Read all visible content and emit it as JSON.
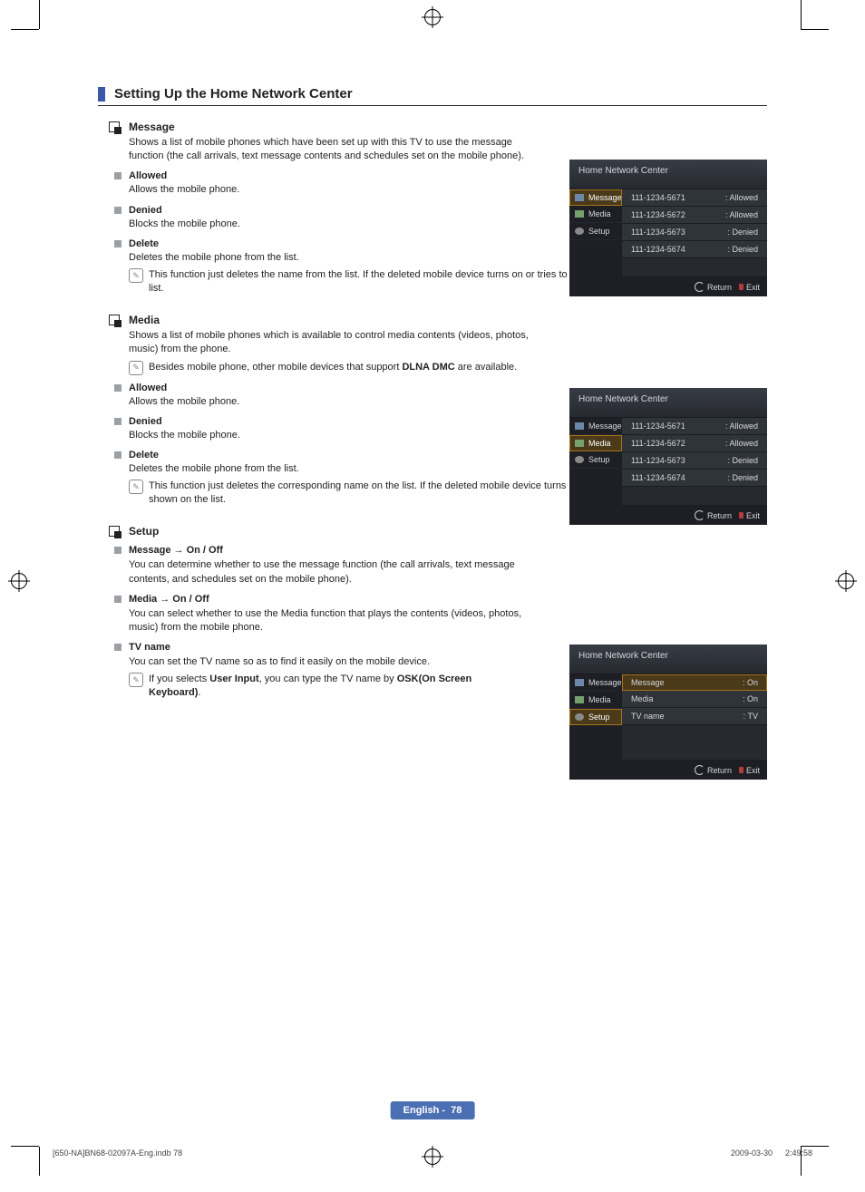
{
  "title": "Setting Up the Home Network Center",
  "sections": {
    "message": {
      "label": "Message",
      "desc": "Shows a list of mobile phones which have been set up with this TV to use the message function (the call arrivals, text message contents and schedules set on the mobile phone).",
      "allowed": {
        "label": "Allowed",
        "text": "Allows the mobile phone."
      },
      "denied": {
        "label": "Denied",
        "text": "Blocks the mobile phone."
      },
      "delete": {
        "label": "Delete",
        "text": "Deletes the mobile phone from the list.",
        "note": "This function just deletes the name from the list. If the deleted mobile device turns on or tries to connect to the TV, it may be shown on the list."
      }
    },
    "media": {
      "label": "Media",
      "desc": "Shows a list of mobile phones which is available to control media contents (videos, photos, music) from the phone.",
      "note_prefix": "Besides mobile phone, other mobile devices that support ",
      "note_bold": "DLNA DMC",
      "note_suffix": " are available.",
      "allowed": {
        "label": "Allowed",
        "text": "Allows the mobile phone."
      },
      "denied": {
        "label": "Denied",
        "text": "Blocks the mobile phone."
      },
      "delete": {
        "label": "Delete",
        "text": "Deletes the mobile phone from the list.",
        "note": "This function just deletes the corresponding name on the list. If the deleted mobile device turns on or tries to connect to the TV, it may be shown on the list."
      }
    },
    "setup": {
      "label": "Setup",
      "msg": {
        "label": "Message → On / Off",
        "text": "You can determine whether to use the message function (the call arrivals, text message contents, and schedules set on the mobile phone)."
      },
      "media": {
        "label": "Media → On / Off",
        "text": "You can select whether to use the Media function that plays the contents (videos, photos, music) from the mobile phone."
      },
      "tv": {
        "label": "TV name",
        "text": "You can set the TV name so as to find it easily on the mobile device.",
        "note_prefix": "If you selects ",
        "note_bold1": "User Input",
        "note_mid": ", you can type the TV name by ",
        "note_bold2": "OSK(On Screen Keyboard)",
        "note_end": "."
      }
    }
  },
  "ui": {
    "title": "Home Network Center",
    "side": {
      "message": "Message",
      "media": "Media",
      "setup": "Setup"
    },
    "rows": [
      {
        "num": "111-1234-5671",
        "stat": ": Allowed"
      },
      {
        "num": "111-1234-5672",
        "stat": ": Allowed"
      },
      {
        "num": "111-1234-5673",
        "stat": ": Denied"
      },
      {
        "num": "111-1234-5674",
        "stat": ": Denied"
      }
    ],
    "setup_rows": [
      {
        "k": "Message",
        "v": ": On"
      },
      {
        "k": "Media",
        "v": ": On"
      },
      {
        "k": "TV name",
        "v": ": TV"
      }
    ],
    "foot": {
      "return": "Return",
      "exit": "Exit"
    }
  },
  "footer": {
    "lang": "English - ",
    "page": "78"
  },
  "docfoot": {
    "left": "[650-NA]BN68-02097A-Eng.indb   78",
    "right": "2009-03-30      2:49:58"
  }
}
